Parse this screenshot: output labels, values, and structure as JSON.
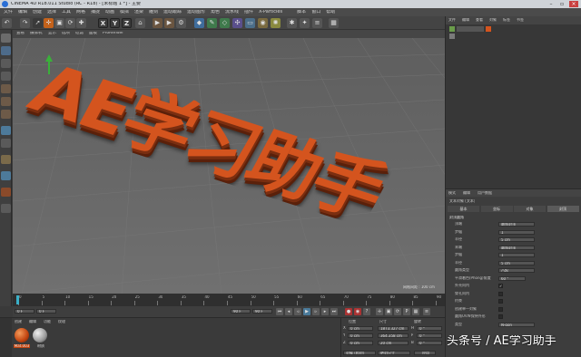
{
  "titlebar": {
    "title": "CINEMA 4D R18.011 Studio (RC - R18) - [未标题 1 *] - 主要"
  },
  "menu": [
    "文件",
    "编辑",
    "创建",
    "选择",
    "工具",
    "网格",
    "捕捉",
    "动画",
    "模拟",
    "渲染",
    "雕刻",
    "运动跟踪",
    "运动图形",
    "角色",
    "流水线",
    "插件",
    "X-Particles",
    "脚本",
    "窗口",
    "帮助"
  ],
  "toolbar": {
    "axis_x": "X",
    "axis_y": "Y",
    "axis_z": "Z"
  },
  "viewport": {
    "menu": [
      "查看",
      "摄像机",
      "显示",
      "选项",
      "过滤",
      "面板",
      "ProRender"
    ],
    "text3d": "AE学习助手",
    "grid_label": "网格间距 : 100 cm"
  },
  "object_manager": {
    "menu": [
      "文件",
      "编辑",
      "查看",
      "对象",
      "标签",
      "书签"
    ]
  },
  "attribute_manager": {
    "menu": [
      "模式",
      "编辑",
      "用户数据"
    ],
    "tabs": [
      "基本",
      "坐标",
      "对象",
      "封顶"
    ],
    "object_title": "文本对象 [文本]",
    "section": "封顶圆角",
    "rows": [
      {
        "label": "顶端",
        "value": "圆角封顶"
      },
      {
        "label": "步幅",
        "value": "1"
      },
      {
        "label": "半径",
        "value": "5 cm"
      },
      {
        "label": "末端",
        "value": "圆角封顶"
      },
      {
        "label": "步幅",
        "value": "1"
      },
      {
        "label": "半径",
        "value": "5 cm"
      },
      {
        "label": "圆角类型",
        "value": "凸起"
      },
      {
        "label": "平滑着色(Phong)角度",
        "value": "60 °"
      },
      {
        "label": "外壳向内",
        "value": "✓"
      },
      {
        "label": "穿孔向内",
        "value": ""
      },
      {
        "label": "约束",
        "value": ""
      },
      {
        "label": "创建单一对象",
        "value": ""
      },
      {
        "label": "圆角UVW保持外形",
        "value": ""
      },
      {
        "label": "类型",
        "value": "N-gon"
      }
    ]
  },
  "timeline": {
    "ticks": [
      "0",
      "5",
      "10",
      "15",
      "20",
      "25",
      "30",
      "35",
      "40",
      "45",
      "50",
      "55",
      "60",
      "65",
      "70",
      "75",
      "80",
      "85",
      "90"
    ],
    "start": "0 F",
    "current": "0 F",
    "end": "90 F",
    "end2": "90 F",
    "frame": "0 F"
  },
  "material_manager": {
    "menu": [
      "创建",
      "编辑",
      "功能",
      "纹理"
    ],
    "materials": [
      "Mat.003",
      "材质"
    ]
  },
  "coordinates": {
    "headers": [
      "位置",
      "尺寸",
      "旋转"
    ],
    "rows": [
      {
        "axis": "X",
        "pos": "0 cm",
        "size": "1873.327 cm",
        "rot_label": "H",
        "rot": "0 °"
      },
      {
        "axis": "Y",
        "pos": "0 cm",
        "size": "364.358 cm",
        "rot_label": "P",
        "rot": "0 °"
      },
      {
        "axis": "Z",
        "pos": "0 cm",
        "size": "20 cm",
        "rot_label": "B",
        "rot": "0 °"
      }
    ],
    "mode": "对象 (相对)",
    "size_mode": "绝对尺寸",
    "apply": "应用"
  },
  "watermark": "头条号 / AE学习助手",
  "colors": {
    "text3d": "#d4541e",
    "viewport_bg": "#646464",
    "accent": "#e07a2e"
  }
}
